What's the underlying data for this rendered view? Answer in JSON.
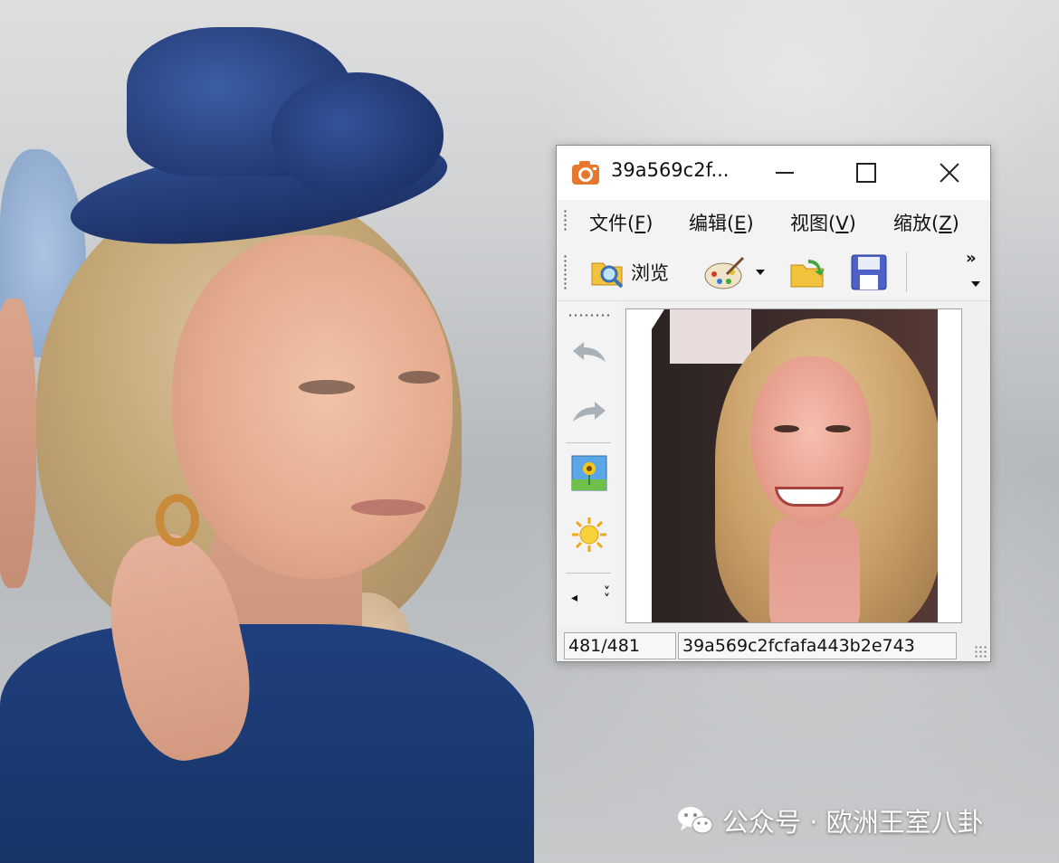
{
  "window": {
    "title": "39a569c2f...",
    "menu": [
      {
        "label": "文件",
        "key": "F"
      },
      {
        "label": "编辑",
        "key": "E"
      },
      {
        "label": "视图",
        "key": "V"
      },
      {
        "label": "缩放",
        "key": "Z"
      }
    ],
    "toolbar": {
      "browse_label": "浏览",
      "overflow": "»"
    },
    "status": {
      "index": "481/481",
      "filename": "39a569c2fcfafa443b2e743"
    }
  },
  "watermark": {
    "text": "公众号 · 欧洲王室八卦"
  },
  "colors": {
    "accent_icon": "#e8772e",
    "window_bg": "#f0f0f0"
  }
}
